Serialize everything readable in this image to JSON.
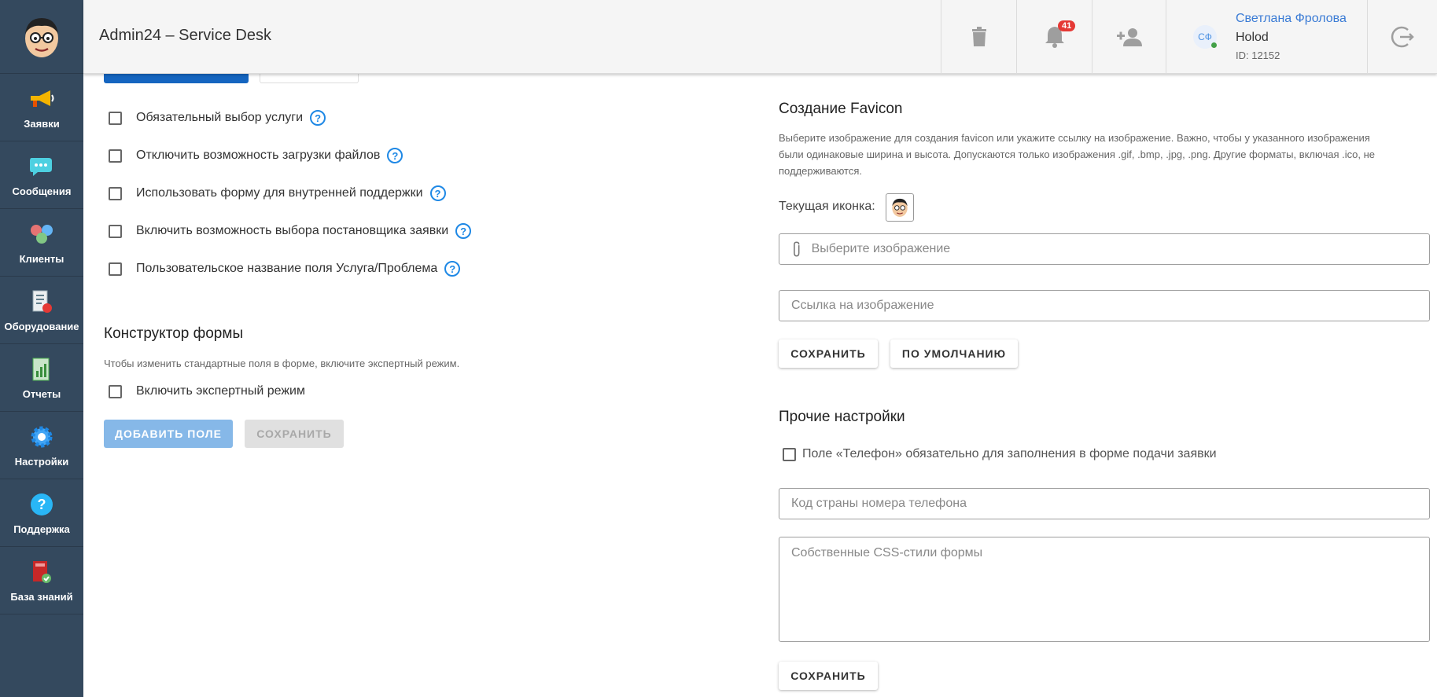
{
  "header": {
    "title": "Admin24 – Service Desk",
    "notifications_count": "41",
    "user": {
      "initials": "СФ",
      "name": "Светлана Фролова",
      "org": "Holod",
      "id": "ID: 12152"
    }
  },
  "sidebar": {
    "items": [
      {
        "label": "Заявки",
        "icon": "megaphone-icon"
      },
      {
        "label": "Сообщения",
        "icon": "chat-bubble-icon"
      },
      {
        "label": "Клиенты",
        "icon": "clients-icon"
      },
      {
        "label": "Оборудование",
        "icon": "equipment-icon"
      },
      {
        "label": "Отчеты",
        "icon": "report-icon"
      },
      {
        "label": "Настройки",
        "icon": "gear-icon"
      },
      {
        "label": "Поддержка",
        "icon": "question-icon"
      },
      {
        "label": "База знаний",
        "icon": "book-icon"
      }
    ]
  },
  "left": {
    "options": [
      "Обязательный выбор услуги",
      "Отключить возможность загрузки файлов",
      "Использовать форму для внутренней поддержки",
      "Включить возможность выбора постановщика заявки",
      "Пользовательское название поля Услуга/Проблема"
    ],
    "constructor": {
      "title": "Конструктор формы",
      "hint": "Чтобы изменить стандартные поля в форме, включите экспертный режим.",
      "expert_mode": "Включить экспертный режим",
      "add_field": "ДОБАВИТЬ ПОЛЕ",
      "save": "СОХРАНИТЬ"
    }
  },
  "favicon": {
    "title": "Создание Favicon",
    "hint_line1": "Выберите изображение для создания favicon или укажите ссылку на изображение. Важно, чтобы у указанного изображения",
    "hint_line2": "были одинаковые ширина и высота. Допускаются только изображения .gif, .bmp, .jpg, .png. Другие форматы, включая .ico, не",
    "hint_line3": "поддерживаются.",
    "current_icon_label": "Текущая иконка:",
    "choose_image_placeholder": "Выберите изображение",
    "image_link_placeholder": "Ссылка на изображение",
    "save": "СОХРАНИТЬ",
    "default": "ПО УМОЛЧАНИЮ"
  },
  "other": {
    "title": "Прочие настройки",
    "phone_required": "Поле «Телефон» обязательно для заполнения в форме подачи заявки",
    "country_code_placeholder": "Код страны номера телефона",
    "css_placeholder": "Собственные CSS-стили формы",
    "save": "СОХРАНИТЬ"
  },
  "colors": {
    "sidebar_bg": "#34495e",
    "accent": "#1e88e5",
    "badge": "#e53935"
  }
}
